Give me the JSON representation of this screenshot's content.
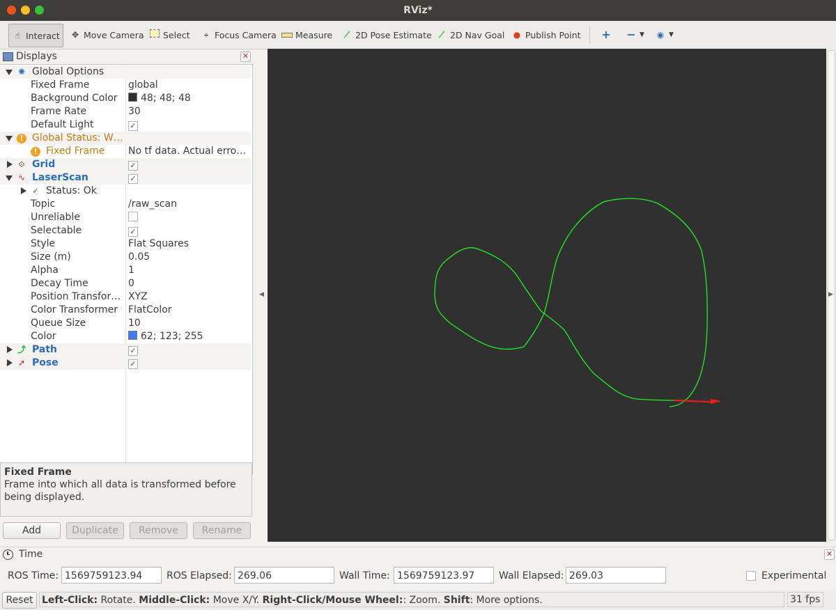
{
  "window": {
    "title": "RViz*"
  },
  "toolbar": {
    "interact": "Interact",
    "move_camera": "Move Camera",
    "select": "Select",
    "focus_camera": "Focus Camera",
    "measure": "Measure",
    "pose_estimate": "2D Pose Estimate",
    "nav_goal": "2D Nav Goal",
    "publish_point": "Publish Point"
  },
  "displays": {
    "title": "Displays",
    "global_options": "Global Options",
    "fixed_frame_key": "Fixed Frame",
    "fixed_frame_val": "global",
    "bg_color_key": "Background Color",
    "bg_color_val": "48; 48; 48",
    "frame_rate_key": "Frame Rate",
    "frame_rate_val": "30",
    "default_light_key": "Default Light",
    "global_status": "Global Status: W…",
    "gs_fixed_frame_key": "Fixed Frame",
    "gs_fixed_frame_val": "No tf data.  Actual erro…",
    "grid": "Grid",
    "laserscan": "LaserScan",
    "status_ok": "Status: Ok",
    "topic_key": "Topic",
    "topic_val": "/raw_scan",
    "unreliable_key": "Unreliable",
    "selectable_key": "Selectable",
    "style_key": "Style",
    "style_val": "Flat Squares",
    "size_key": "Size (m)",
    "size_val": "0.05",
    "alpha_key": "Alpha",
    "alpha_val": "1",
    "decay_key": "Decay Time",
    "decay_val": "0",
    "pos_tf_key": "Position Transfor…",
    "pos_tf_val": "XYZ",
    "color_tf_key": "Color Transformer",
    "color_tf_val": "FlatColor",
    "queue_key": "Queue Size",
    "queue_val": "10",
    "color_key": "Color",
    "color_val": "62; 123; 255",
    "path": "Path",
    "pose": "Pose"
  },
  "description": {
    "title": "Fixed Frame",
    "text": "Frame into which all data is transformed before being displayed."
  },
  "buttons": {
    "add": "Add",
    "duplicate": "Duplicate",
    "remove": "Remove",
    "rename": "Rename"
  },
  "time": {
    "title": "Time",
    "ros_time_label": "ROS Time:",
    "ros_time": "1569759123.94",
    "ros_elapsed_label": "ROS Elapsed:",
    "ros_elapsed": "269.06",
    "wall_time_label": "Wall Time:",
    "wall_time": "1569759123.97",
    "wall_elapsed_label": "Wall Elapsed:",
    "wall_elapsed": "269.03",
    "experimental": "Experimental"
  },
  "status": {
    "reset": "Reset",
    "k1": "Left-Click:",
    "t1": " Rotate. ",
    "k2": "Middle-Click:",
    "t2": " Move X/Y. ",
    "k3": "Right-Click/Mouse Wheel:",
    "t3": ": Zoom. ",
    "k4": "Shift",
    "t4": ": More options.",
    "fps": "31 fps"
  },
  "colors": {
    "background": "#303030",
    "path": "#00ff00",
    "pose_arrow": "#ff0000",
    "laserscan": "#3e7bff"
  },
  "icons": [
    "hand-icon",
    "move-camera-icon",
    "select-icon",
    "focus-camera-icon",
    "ruler-icon",
    "pose-estimate-icon",
    "nav-goal-icon",
    "publish-point-icon",
    "plus-icon",
    "minus-icon",
    "eye-icon"
  ]
}
